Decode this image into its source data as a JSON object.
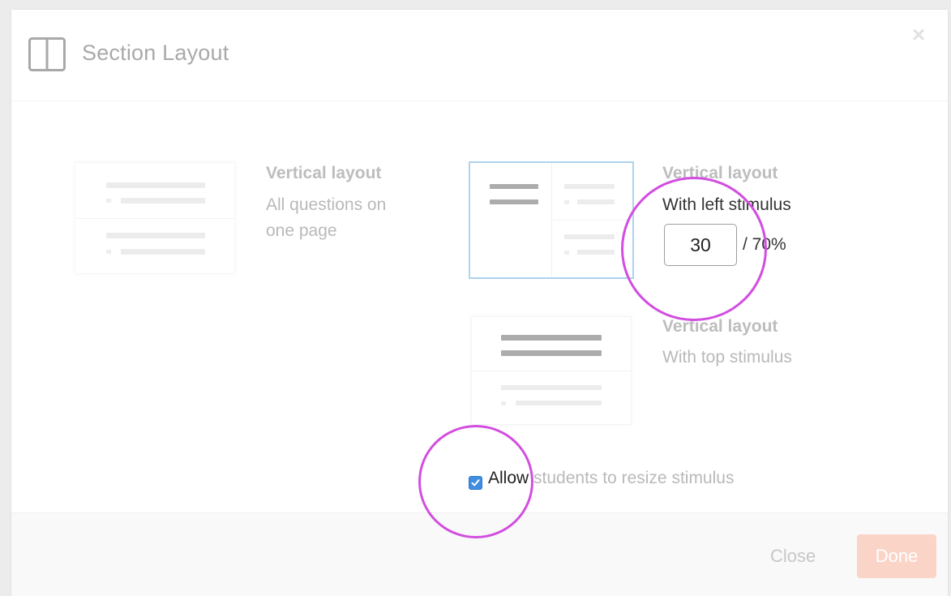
{
  "dialog": {
    "title": "Section Layout",
    "close_icon": "close-icon",
    "header_icon": "two-column-layout-icon"
  },
  "options": [
    {
      "title": "Vertical layout",
      "subtitle": "All questions on one page",
      "selected": false
    },
    {
      "title": "Vertical layout",
      "subtitle": "With left stimulus",
      "selected": true,
      "stimulus_width_value": "30",
      "stimulus_width_max": "/ 70%"
    },
    {
      "title": "Vertical layout",
      "subtitle": "With top stimulus",
      "selected": false
    }
  ],
  "resize": {
    "checked": true,
    "label_emphasis": "Allow",
    "label_rest": " students to resize stimulus"
  },
  "footer": {
    "close_label": "Close",
    "done_label": "Done"
  },
  "colors": {
    "accent_blue": "#3f8ee0",
    "selected_border": "#aed3ef",
    "done_button": "#fbd4c8",
    "highlight_circle": "#d24ee0"
  }
}
